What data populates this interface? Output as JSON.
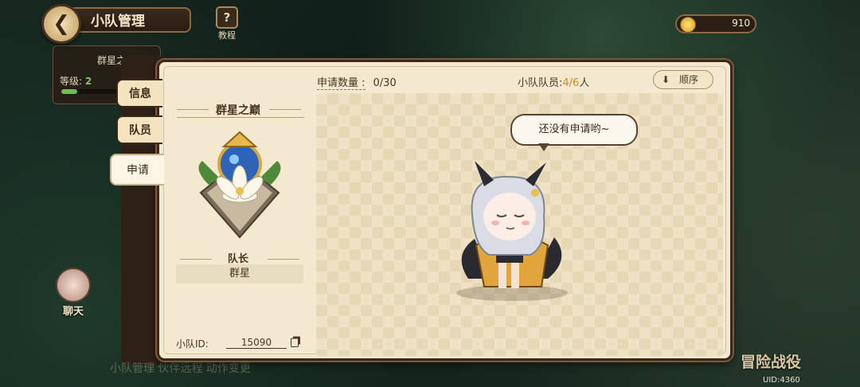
{
  "header": {
    "title": "小队管理",
    "tutorial_label": "教程",
    "currency_value": "910"
  },
  "team_info": {
    "name": "群星之",
    "level_label": "等级:",
    "level_value": "2",
    "exp_fraction": 0.18
  },
  "tabs": [
    {
      "label": "信息"
    },
    {
      "label": "队员"
    },
    {
      "label": "申请",
      "active": true
    }
  ],
  "panel": {
    "team_name": "群星之巅",
    "leader_label": "队长",
    "leader_name": "群星",
    "team_id_label": "小队ID:",
    "team_id": "15090",
    "request_label": "申请数量 :",
    "request_value": "0/30",
    "members_label": "小队队员:",
    "members_current": "4/6",
    "members_unit": "人",
    "sort_label": "顺序",
    "empty_message": "还没有申请哟~"
  },
  "side": {
    "chat_label": "聊天",
    "campaign_label": "冒险战役",
    "uid_label": "UID:4360",
    "bottom_text": "小队管理  伙伴远程  动作变更"
  },
  "colors": {
    "accent_orange": "#d48a1c",
    "panel_bg": "#f3e8d0",
    "frame_brown": "#3b2819",
    "exp_green": "#6ec04a"
  },
  "icons": [
    "back-arrow-icon",
    "question-icon",
    "coin-icon",
    "copy-icon",
    "sort-arrow-icon",
    "team-emblem-icon"
  ]
}
